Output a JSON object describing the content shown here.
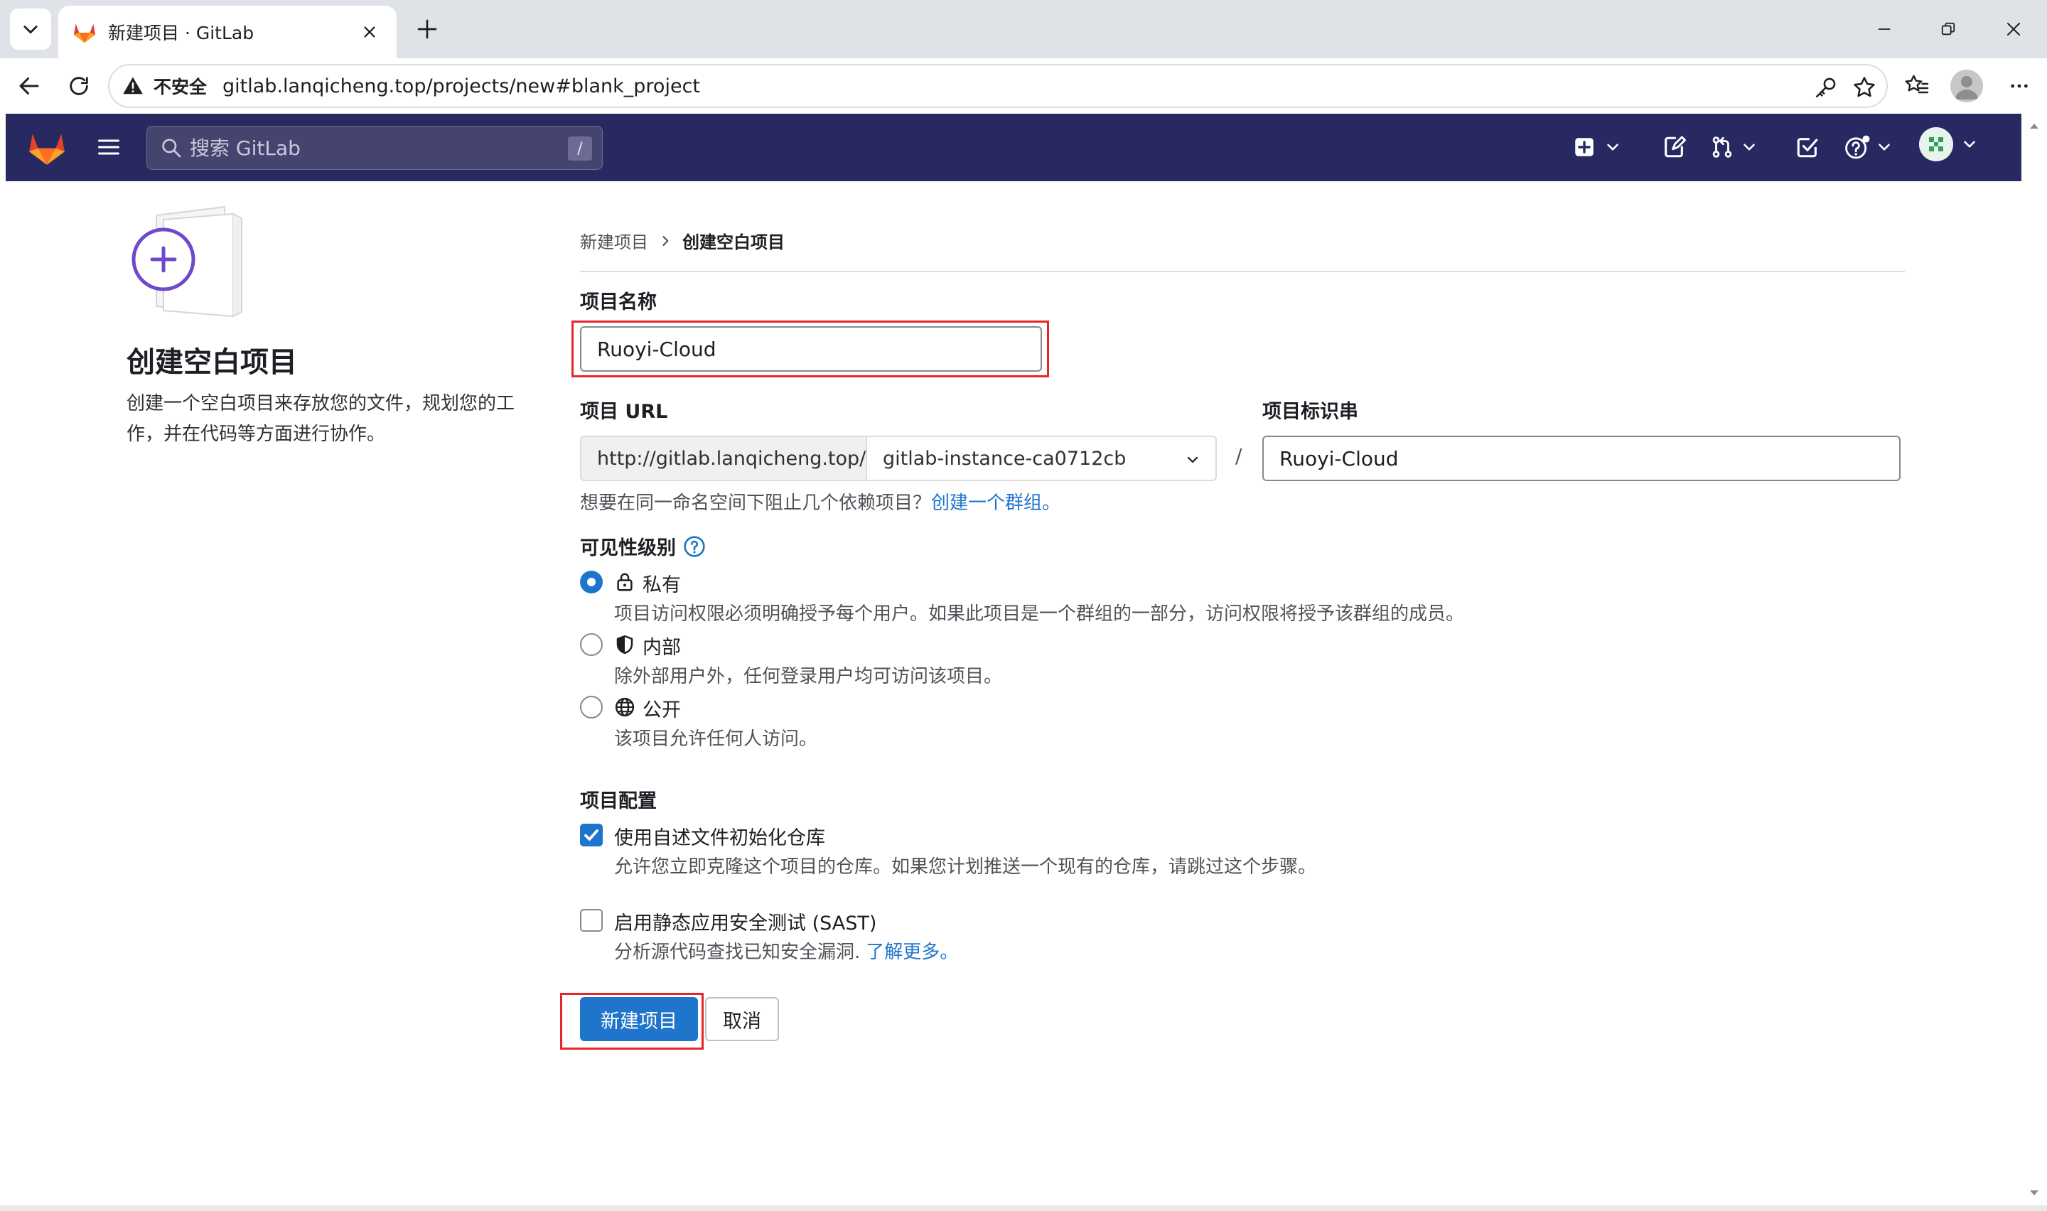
{
  "browser": {
    "tab_title": "新建项目 · GitLab",
    "insecure_label": "不安全",
    "url": "gitlab.lanqicheng.top/projects/new#blank_project"
  },
  "gitlab_header": {
    "search_placeholder": "搜索 GitLab",
    "search_shortcut": "/"
  },
  "sidebar": {
    "title": "创建空白项目",
    "description": "创建一个空白项目来存放您的文件，规划您的工作，并在代码等方面进行协作。"
  },
  "breadcrumb": {
    "parent": "新建项目",
    "current": "创建空白项目"
  },
  "form": {
    "project_name_label": "项目名称",
    "project_name_value": "Ruoyi-Cloud",
    "project_url_label": "项目 URL",
    "url_prefix": "http://gitlab.lanqicheng.top/",
    "namespace_value": "gitlab-instance-ca0712cb",
    "path_separator": "/",
    "slug_label": "项目标识串",
    "slug_value": "Ruoyi-Cloud",
    "group_hint": "想要在同一命名空间下阻止几个依赖项目？",
    "group_hint_link": "创建一个群组。",
    "visibility_label": "可见性级别",
    "visibility_options": [
      {
        "label": "私有",
        "icon": "lock-icon",
        "description": "项目访问权限必须明确授予每个用户。如果此项目是一个群组的一部分，访问权限将授予该群组的成员。",
        "selected": true
      },
      {
        "label": "内部",
        "icon": "shield-icon",
        "description": "除外部用户外，任何登录用户均可访问该项目。",
        "selected": false
      },
      {
        "label": "公开",
        "icon": "earth-icon",
        "description": "该项目允许任何人访问。",
        "selected": false
      }
    ],
    "config_label": "项目配置",
    "init_readme_label": "使用自述文件初始化仓库",
    "init_readme_desc": "允许您立即克隆这个项目的仓库。如果您计划推送一个现有的仓库，请跳过这个步骤。",
    "init_readme_checked": true,
    "sast_label": "启用静态应用安全测试 (SAST)",
    "sast_desc": "分析源代码查找已知安全漏洞.",
    "sast_link": "了解更多。",
    "sast_checked": false,
    "submit_label": "新建项目",
    "cancel_label": "取消"
  },
  "colors": {
    "header_bg": "#292961",
    "primary": "#1f75cb",
    "highlight": "#e5262b"
  }
}
